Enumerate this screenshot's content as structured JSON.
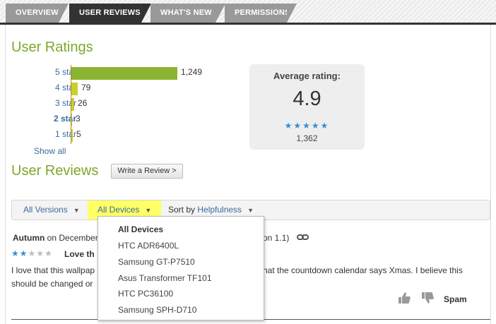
{
  "tabs": [
    {
      "label": "OVERVIEW",
      "active": false
    },
    {
      "label": "USER REVIEWS",
      "active": true
    },
    {
      "label": "WHAT'S NEW",
      "active": false
    },
    {
      "label": "PERMISSIONS",
      "active": false
    }
  ],
  "ratings": {
    "heading": "User Ratings",
    "rows": [
      {
        "label": "5 star",
        "count": "1,249",
        "value": 1249
      },
      {
        "label": "4 star",
        "count": "79",
        "value": 79
      },
      {
        "label": "3 star",
        "count": "26",
        "value": 26
      },
      {
        "label": "2 star",
        "count": "3",
        "value": 3
      },
      {
        "label": "1 star",
        "count": "5",
        "value": 5
      }
    ],
    "show_all": "Show all",
    "average_title": "Average rating:",
    "average_value": "4.9",
    "average_stars": "★★★★★",
    "total_count": "1,362"
  },
  "reviews": {
    "heading": "User Reviews",
    "write_button": "Write a Review >"
  },
  "filters": {
    "versions": "All Versions",
    "devices": "All Devices",
    "sort_prefix": "Sort by",
    "sort_value": "Helpfulness",
    "caret": "▼"
  },
  "dropdown": {
    "items": [
      "All Devices",
      "HTC ADR6400L",
      "Samsung GT-P7510",
      "Asus Transformer TF101",
      "HTC PC36100",
      "Samsung SPH-D710"
    ]
  },
  "review": {
    "author": "Autumn",
    "date_partial": "on December",
    "version_partial": "on 1.1)",
    "stars_on": "★★",
    "stars_off": "★★★",
    "title_partial": "Love th",
    "body_line1_a": "I love that this wallpap",
    "body_line1_b": "hat the countdown calendar says Xmas. I believe this",
    "body_line2": "should be changed or",
    "spam": "Spam"
  },
  "colors": {
    "accent_green": "#7fa72c",
    "bar_green": "#8bb431",
    "bar_yellow": "#c9cf2d",
    "link_blue": "#3b6aa0",
    "star_blue": "#3b8ed0",
    "highlight_yellow": "#ffff66"
  }
}
